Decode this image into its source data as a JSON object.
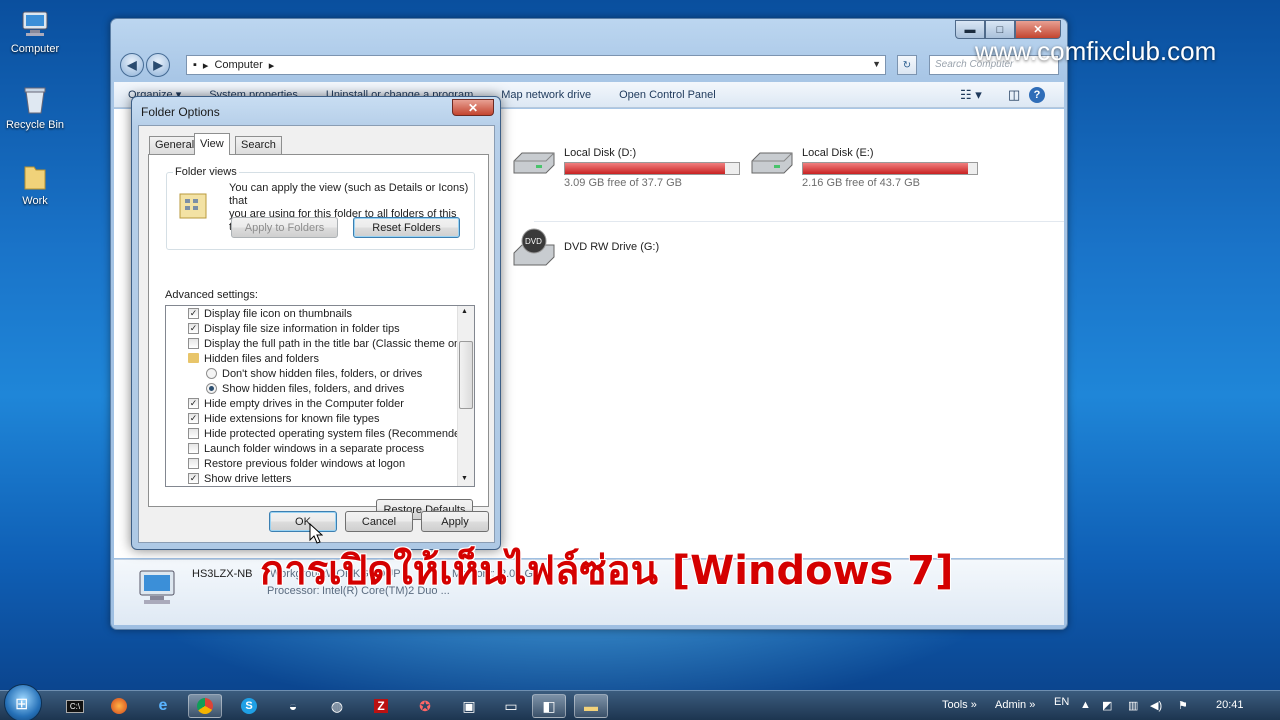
{
  "desktop": {
    "icons": [
      {
        "label": "Computer",
        "icon": "computer-icon"
      },
      {
        "label": "Recycle Bin",
        "icon": "recycle-bin-icon"
      },
      {
        "label": "Work",
        "icon": "folder-icon"
      }
    ]
  },
  "explorer": {
    "breadcrumb": "Computer",
    "search_placeholder": "Search Computer",
    "toolbar": {
      "organize": "Organize ▾",
      "system_properties": "System properties",
      "uninstall": "Uninstall or change a program",
      "map_drive": "Map network drive",
      "control_panel": "Open Control Panel"
    },
    "drives": [
      {
        "name": "Local Disk (D:)",
        "free_text": "3.09 GB free of 37.7 GB",
        "used_fraction": 0.92
      },
      {
        "name": "Local Disk (E:)",
        "free_text": "2.16 GB free of 43.7 GB",
        "used_fraction": 0.95
      }
    ],
    "dvd": {
      "name": "DVD RW Drive (G:)",
      "badge": "DVD"
    },
    "details": {
      "name": "HS3LZX-NB",
      "workgroup_label": "Workgroup:",
      "workgroup": "WORKGROUP",
      "memory_label": "Memory:",
      "memory": "2.00 GB",
      "processor_label": "Processor:",
      "processor": "Intel(R) Core(TM)2 Duo ..."
    }
  },
  "dialog": {
    "title": "Folder Options",
    "tabs": [
      "General",
      "View",
      "Search"
    ],
    "active_tab": "View",
    "folder_views": {
      "legend": "Folder views",
      "line1": "You can apply the view (such as Details or Icons) that",
      "line2": "you are using for this folder to all folders of this type.",
      "apply_to_folders": "Apply to Folders",
      "reset_folders": "Reset Folders"
    },
    "advanced_label": "Advanced settings:",
    "settings": [
      {
        "text": "Display file icon on thumbnails",
        "kind": "check",
        "checked": true
      },
      {
        "text": "Display file size information in folder tips",
        "kind": "check",
        "checked": true
      },
      {
        "text": "Display the full path in the title bar (Classic theme only)",
        "kind": "check",
        "checked": false
      },
      {
        "text": "Hidden files and folders",
        "kind": "folder"
      },
      {
        "text": "Don't show hidden files, folders, or drives",
        "kind": "radio",
        "checked": false
      },
      {
        "text": "Show hidden files, folders, and drives",
        "kind": "radio",
        "checked": true
      },
      {
        "text": "Hide empty drives in the Computer folder",
        "kind": "check",
        "checked": true
      },
      {
        "text": "Hide extensions for known file types",
        "kind": "check",
        "checked": true
      },
      {
        "text": "Hide protected operating system files (Recommended)",
        "kind": "check",
        "checked": false
      },
      {
        "text": "Launch folder windows in a separate process",
        "kind": "check",
        "checked": false
      },
      {
        "text": "Restore previous folder windows at logon",
        "kind": "check",
        "checked": false
      },
      {
        "text": "Show drive letters",
        "kind": "check",
        "checked": true
      }
    ],
    "restore_defaults": "Restore Defaults",
    "ok": "OK",
    "cancel": "Cancel",
    "apply": "Apply"
  },
  "overlay": {
    "watermark": "www.comfixclub.com",
    "caption": "การเปิดให้เห็นไฟล์ซ่อน [Windows 7]"
  },
  "taskbar": {
    "tools": "Tools",
    "admin": "Admin",
    "lang": "EN",
    "clock": "20:41"
  }
}
